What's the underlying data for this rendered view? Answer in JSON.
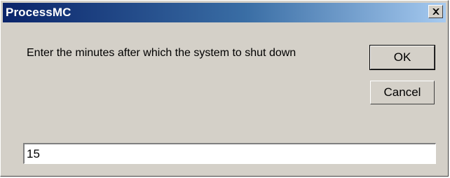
{
  "window": {
    "title": "ProcessMC",
    "close_icon": "close-icon"
  },
  "dialog": {
    "prompt": "Enter the minutes after which the system to shut down",
    "ok_label": "OK",
    "cancel_label": "Cancel"
  },
  "input": {
    "value": "15"
  },
  "colors": {
    "face": "#d4d0c8",
    "title_start": "#0a246a",
    "title_end": "#a6caf0"
  }
}
